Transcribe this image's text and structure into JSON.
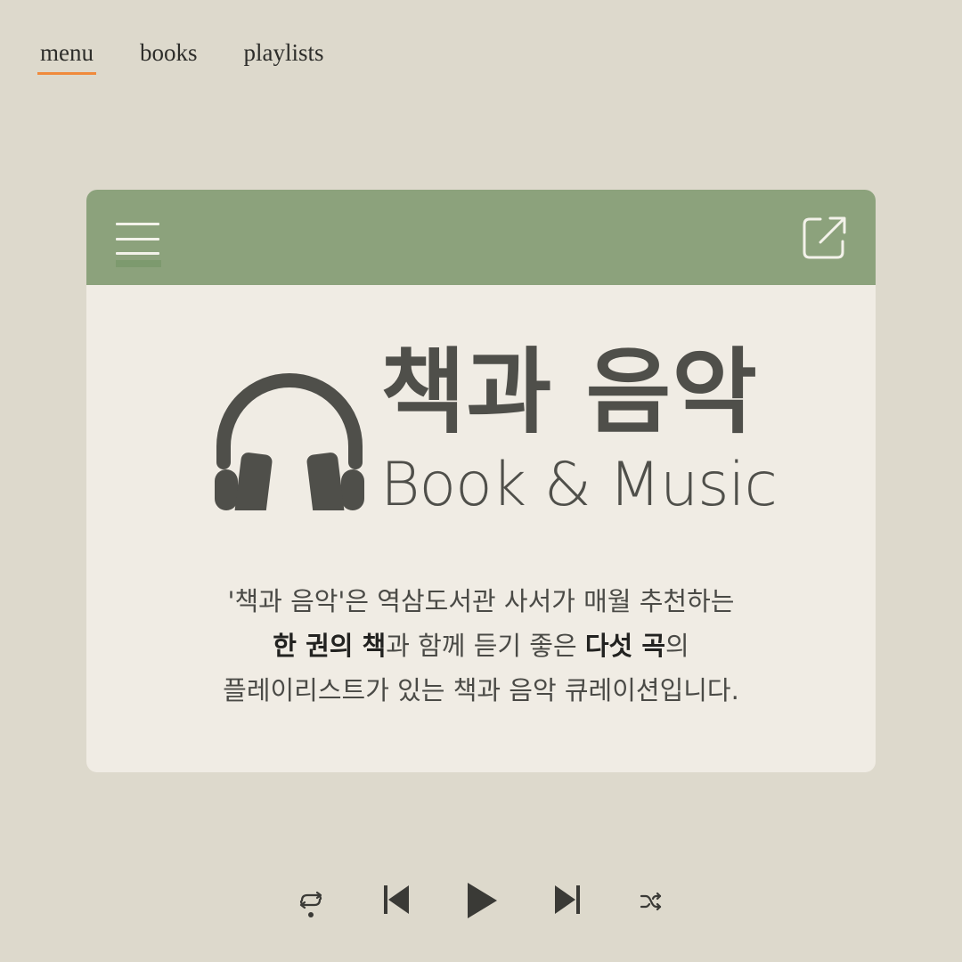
{
  "nav": {
    "tabs": [
      {
        "label": "menu",
        "active": true
      },
      {
        "label": "books",
        "active": false
      },
      {
        "label": "playlists",
        "active": false
      }
    ],
    "active_underline_color": "#f08a3c"
  },
  "card": {
    "header_color": "#8ca27c",
    "header_left_icon": "menu-icon",
    "header_right_icon": "external-link-icon",
    "logo_icon": "headphones-icon",
    "title_ko": "책과 음악",
    "title_en": "Book & Music",
    "description": {
      "line1": "'책과 음악'은 역삼도서관 사서가 매월 추천하는",
      "line2_strong1": "한 권의 책",
      "line2_text1": "과 함께 듣기 좋은 ",
      "line2_strong2": "다섯 곡",
      "line2_text2": "의",
      "line3": "플레이리스트가 있는 책과 음악 큐레이션입니다."
    }
  },
  "player": {
    "controls": [
      "repeat-icon",
      "previous-icon",
      "play-icon",
      "next-icon",
      "shuffle-icon"
    ]
  },
  "colors": {
    "background": "#ddd9cc",
    "card": "#f0ece4",
    "ink": "#4f4f4a"
  }
}
